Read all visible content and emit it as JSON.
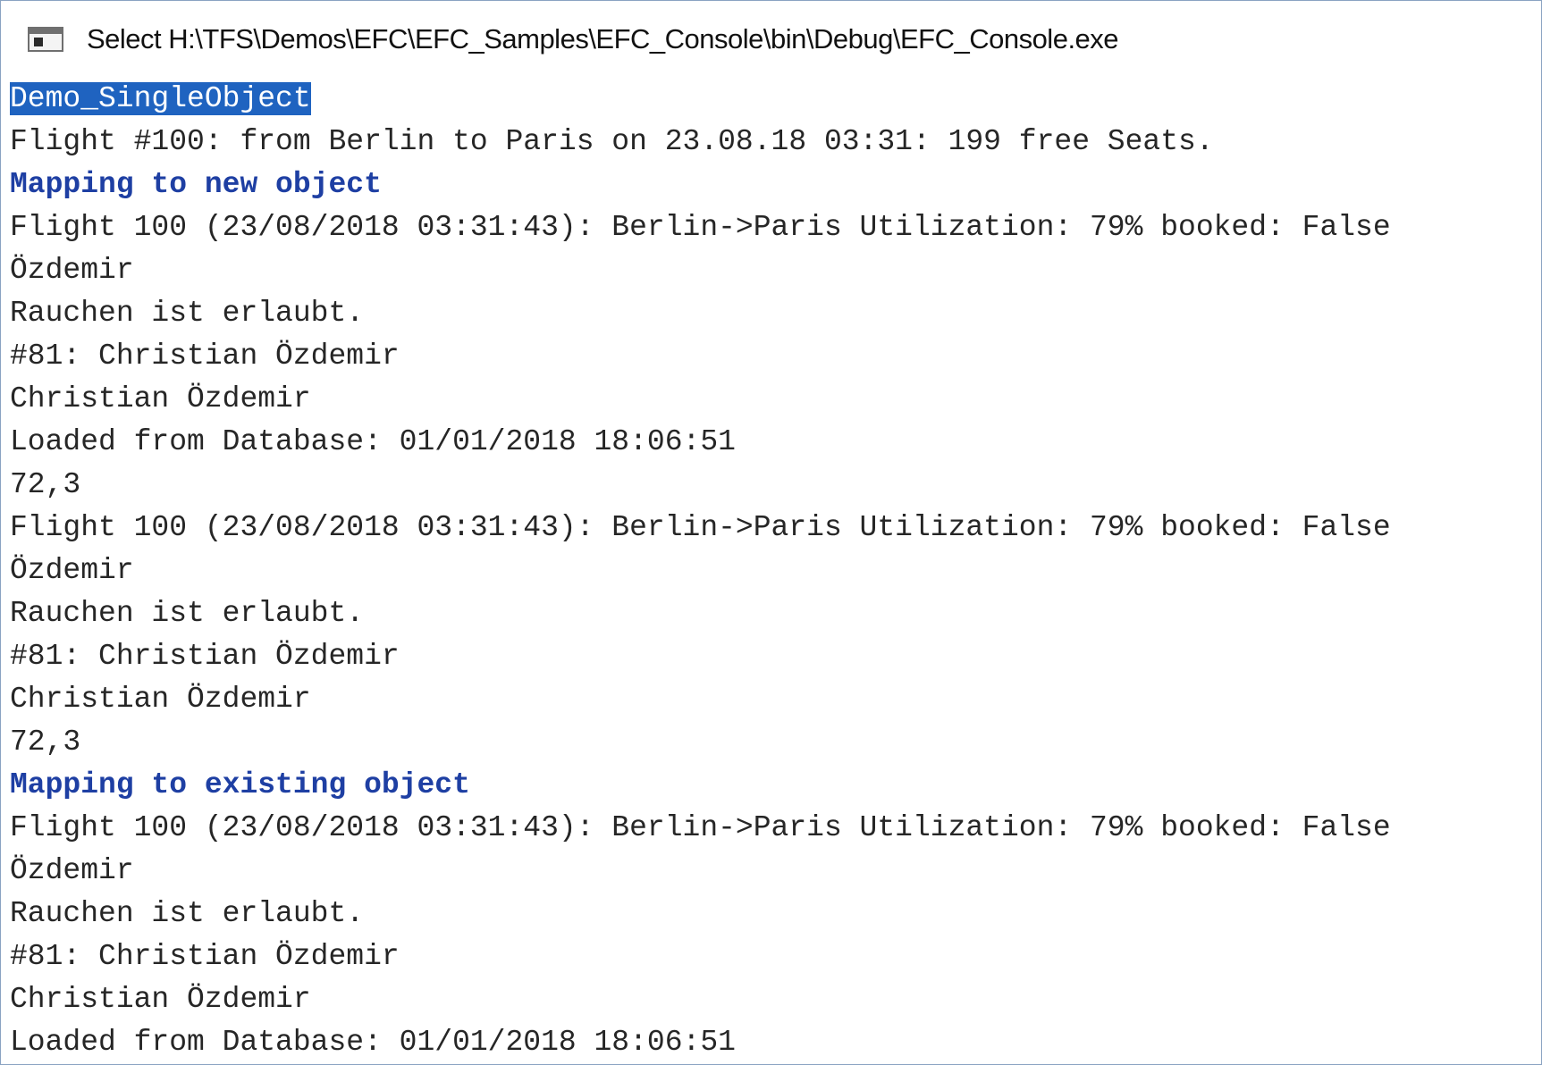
{
  "window": {
    "title": "Select H:\\TFS\\Demos\\EFC\\EFC_Samples\\EFC_Console\\bin\\Debug\\EFC_Console.exe",
    "icon": "console-app-icon"
  },
  "console": {
    "selected_text": "Demo_SingleObject",
    "lines": [
      "Flight #100: from Berlin to Paris on 23.08.18 03:31: 199 free Seats.",
      "Mapping to new object",
      "Flight 100 (23/08/2018 03:31:43): Berlin->Paris Utilization: 79% booked: False",
      "Özdemir",
      "Rauchen ist erlaubt.",
      "#81: Christian Özdemir",
      "Christian Özdemir",
      "Loaded from Database: 01/01/2018 18:06:51",
      "72,3",
      "Flight 100 (23/08/2018 03:31:43): Berlin->Paris Utilization: 79% booked: False",
      "Özdemir",
      "Rauchen ist erlaubt.",
      "#81: Christian Özdemir",
      "Christian Özdemir",
      "72,3",
      "Mapping to existing object",
      "Flight 100 (23/08/2018 03:31:43): Berlin->Paris Utilization: 79% booked: False",
      "Özdemir",
      "Rauchen ist erlaubt.",
      "#81: Christian Özdemir",
      "Christian Özdemir",
      "Loaded from Database: 01/01/2018 18:06:51"
    ]
  },
  "colors": {
    "heading_text": "#1e3fa3",
    "selection_bg": "#1f63c0",
    "normal_text": "#262626"
  }
}
